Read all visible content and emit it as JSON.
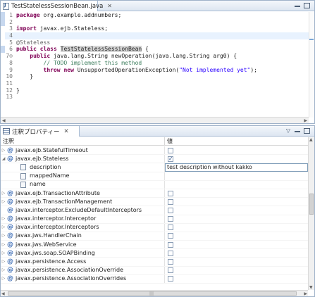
{
  "editor": {
    "tab_label": "TestStatelessSessionBean.java",
    "tab_close": "✕",
    "lines": [
      {
        "n": "1",
        "segments": [
          {
            "t": "package ",
            "c": "kw"
          },
          {
            "t": "org.example.addnumbers;",
            "c": ""
          }
        ]
      },
      {
        "n": "2",
        "segments": []
      },
      {
        "n": "3",
        "segments": [
          {
            "t": "import ",
            "c": "kw"
          },
          {
            "t": "javax.ejb.Stateless;",
            "c": ""
          }
        ]
      },
      {
        "n": "4",
        "segments": [],
        "current": true
      },
      {
        "n": "5",
        "segments": [
          {
            "t": "@Stateless",
            "c": "an"
          }
        ]
      },
      {
        "n": "6",
        "segments": [
          {
            "t": "public ",
            "c": "kw"
          },
          {
            "t": "class ",
            "c": "kw"
          },
          {
            "t": "TestStatelessSessionBean",
            "c": "hl"
          },
          {
            "t": " {",
            "c": ""
          }
        ]
      },
      {
        "n": "7⊖",
        "segments": [
          {
            "t": "    public ",
            "c": "kw"
          },
          {
            "t": "java.lang.String newOperation(java.lang.String arg0) {",
            "c": ""
          }
        ]
      },
      {
        "n": "8",
        "segments": [
          {
            "t": "        // TODO implement this method",
            "c": "cm"
          }
        ]
      },
      {
        "n": "9",
        "segments": [
          {
            "t": "        ",
            "c": ""
          },
          {
            "t": "throw ",
            "c": "kw"
          },
          {
            "t": "new ",
            "c": "kw"
          },
          {
            "t": "UnsupportedOperationException(",
            "c": ""
          },
          {
            "t": "\"Not implemented yet\"",
            "c": "st"
          },
          {
            "t": ");",
            "c": ""
          }
        ]
      },
      {
        "n": "10",
        "segments": [
          {
            "t": "    }",
            "c": ""
          }
        ]
      },
      {
        "n": "11",
        "segments": []
      },
      {
        "n": "12",
        "segments": [
          {
            "t": "}",
            "c": ""
          }
        ]
      },
      {
        "n": "13",
        "segments": []
      }
    ]
  },
  "properties_view": {
    "tab_label": "注釈プロパティー",
    "tab_close": "✕",
    "col_annotation": "注釈",
    "col_value": "値",
    "view_menu_icon": "▽",
    "rows": [
      {
        "kind": "annotation",
        "twisty": "▷",
        "label": "javax.ejb.StatefulTimeout",
        "checked": false
      },
      {
        "kind": "annotation",
        "twisty": "◢",
        "label": "javax.ejb.Stateless",
        "checked": true
      },
      {
        "kind": "property",
        "label": "description",
        "value": "test description without kakko",
        "editing": true
      },
      {
        "kind": "property",
        "label": "mappedName",
        "value": ""
      },
      {
        "kind": "property",
        "label": "name",
        "value": ""
      },
      {
        "kind": "annotation",
        "twisty": "▷",
        "label": "javax.ejb.TransactionAttribute",
        "checked": false
      },
      {
        "kind": "annotation",
        "twisty": "▷",
        "label": "javax.ejb.TransactionManagement",
        "checked": false
      },
      {
        "kind": "annotation",
        "twisty": "",
        "label": "javax.interceptor.ExcludeDefaultInterceptors",
        "checked": false
      },
      {
        "kind": "annotation",
        "twisty": "▷",
        "label": "javax.interceptor.Interceptor",
        "checked": false
      },
      {
        "kind": "annotation",
        "twisty": "▷",
        "label": "javax.interceptor.Interceptors",
        "checked": false
      },
      {
        "kind": "annotation",
        "twisty": "▷",
        "label": "javax.jws.HandlerChain",
        "checked": false
      },
      {
        "kind": "annotation",
        "twisty": "▷",
        "label": "javax.jws.WebService",
        "checked": false
      },
      {
        "kind": "annotation",
        "twisty": "▷",
        "label": "javax.jws.soap.SOAPBinding",
        "checked": false
      },
      {
        "kind": "annotation",
        "twisty": "▷",
        "label": "javax.persistence.Access",
        "checked": false
      },
      {
        "kind": "annotation",
        "twisty": "▷",
        "label": "javax.persistence.AssociationOverride",
        "checked": false
      },
      {
        "kind": "annotation",
        "twisty": "▷",
        "label": "javax.persistence.AssociationOverrides",
        "checked": false
      }
    ]
  },
  "colors": {
    "keyword": "#7f0055",
    "comment": "#3f7f5f",
    "string": "#2a00ff",
    "annotation_icon": "#3b6cb5",
    "current_line": "#e8f2fe"
  }
}
